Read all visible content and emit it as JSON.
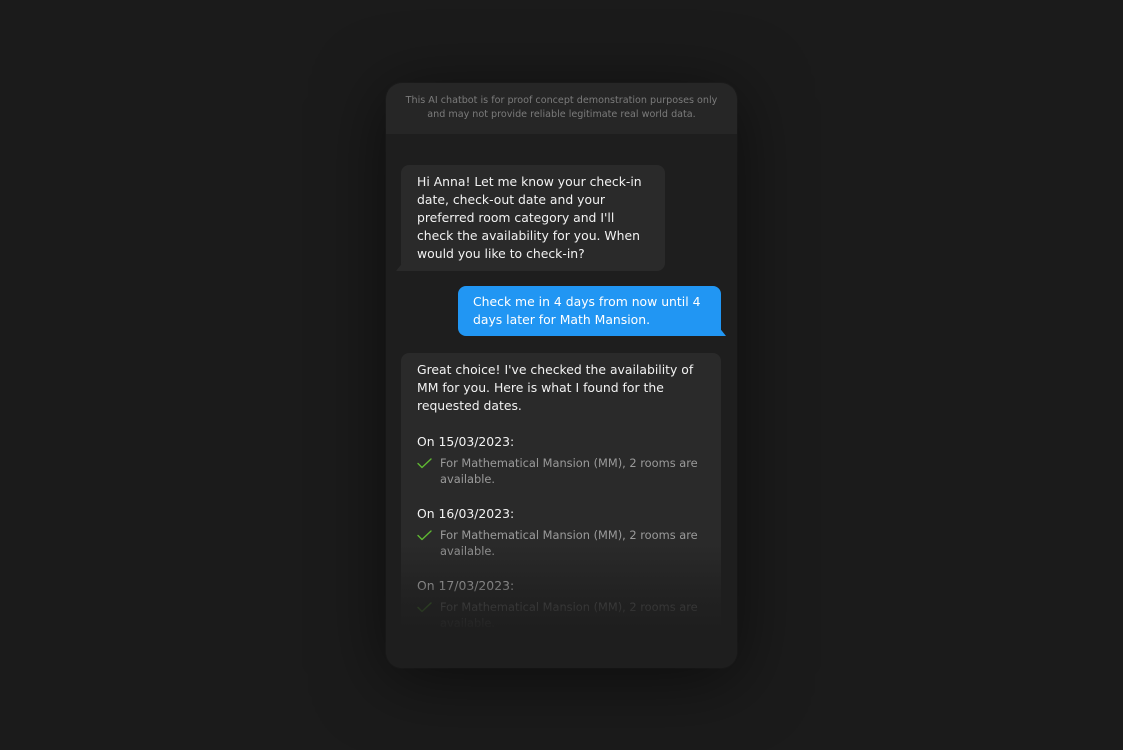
{
  "disclaimer": {
    "line1": "This AI chatbot is for proof concept demonstration purposes only",
    "line2": "and may not provide reliable legitimate real world data."
  },
  "messages": {
    "bot_greeting": "Hi Anna! Let me know your check-in date, check-out date and your preferred room category and I'll check the availability for you. When would you like to check-in?",
    "user_request": "Check me in 4 days from now until 4 days later for Math Mansion.",
    "bot_reply_intro": "Great choice! I've checked the availability of MM for you. Here is what I found for the requested dates.",
    "availability": [
      {
        "date_label": "On 15/03/2023:",
        "detail": "For Mathematical Mansion (MM), 2 rooms are available."
      },
      {
        "date_label": "On 16/03/2023:",
        "detail": "For Mathematical Mansion (MM), 2 rooms are available."
      },
      {
        "date_label": "On 17/03/2023:",
        "detail": "For Mathematical Mansion (MM), 2 rooms are available."
      }
    ]
  },
  "colors": {
    "background": "#1b1b1b",
    "panel": "#1e1e1e",
    "bot_bubble": "#2a2a2a",
    "user_bubble": "#2196f3",
    "check": "#5fb832"
  },
  "icons": {
    "availability_marker": "check-icon"
  }
}
